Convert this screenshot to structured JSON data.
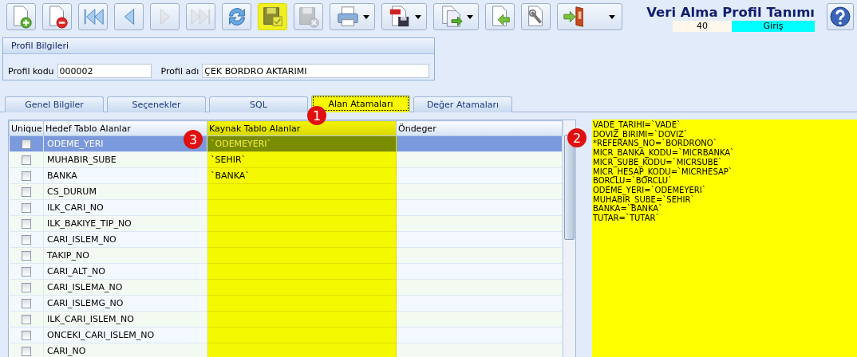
{
  "toolbar": [
    {
      "kind": "new",
      "disabled": false,
      "highlighted": false,
      "dropdown": false
    },
    {
      "kind": "delete",
      "disabled": false,
      "highlighted": false,
      "dropdown": false
    },
    {
      "kind": "first",
      "disabled": false,
      "highlighted": false,
      "dropdown": false
    },
    {
      "kind": "prev",
      "disabled": false,
      "highlighted": false,
      "dropdown": false
    },
    {
      "kind": "next",
      "disabled": true,
      "highlighted": false,
      "dropdown": false
    },
    {
      "kind": "last",
      "disabled": true,
      "highlighted": false,
      "dropdown": false
    },
    {
      "kind": "refresh",
      "disabled": false,
      "highlighted": false,
      "dropdown": false
    },
    {
      "kind": "save",
      "disabled": false,
      "highlighted": true,
      "dropdown": false
    },
    {
      "kind": "cancel",
      "disabled": true,
      "highlighted": false,
      "dropdown": false
    },
    {
      "kind": "print",
      "disabled": false,
      "highlighted": false,
      "dropdown": true
    },
    {
      "kind": "pdf",
      "disabled": false,
      "highlighted": false,
      "dropdown": true
    },
    {
      "kind": "export",
      "disabled": false,
      "highlighted": false,
      "dropdown": true
    },
    {
      "kind": "import",
      "disabled": false,
      "highlighted": false,
      "dropdown": false
    },
    {
      "kind": "tools",
      "disabled": false,
      "highlighted": false,
      "dropdown": false
    },
    {
      "kind": "exit",
      "disabled": false,
      "highlighted": false,
      "dropdown": true
    }
  ],
  "header": {
    "title": "Veri Alma Profil Tanımı",
    "code": "40",
    "mode": "Giriş"
  },
  "profile": {
    "title": "Profil Bilgileri",
    "code_label": "Profil kodu",
    "code_value": "000002",
    "name_label": "Profil adı",
    "name_value": "ÇEK BORDRO AKTARIMI"
  },
  "tabs": [
    {
      "label": "Genel Bilgiler",
      "selected": false
    },
    {
      "label": "Seçenekler",
      "selected": false
    },
    {
      "label": "SQL",
      "selected": false
    },
    {
      "label": "Alan Atamaları",
      "selected": true
    },
    {
      "label": "Değer Atamaları",
      "selected": false
    }
  ],
  "callouts": [
    "1",
    "2",
    "3"
  ],
  "table": {
    "columns": [
      "Unique",
      "Hedef Tablo Alanlar",
      "Kaynak Tablo Alanlar",
      "Öndeger"
    ],
    "rows": [
      {
        "unique": false,
        "target": "ODEME_YERI",
        "source": "`ODEMEYERI`",
        "selected": true
      },
      {
        "unique": false,
        "target": "MUHABIR_SUBE",
        "source": "`SEHIR`",
        "selected": false
      },
      {
        "unique": false,
        "target": "BANKA",
        "source": "`BANKA`",
        "selected": false
      },
      {
        "unique": false,
        "target": "CS_DURUM",
        "selected": false
      },
      {
        "unique": false,
        "target": "ILK_CARI_NO",
        "selected": false
      },
      {
        "unique": false,
        "target": "ILK_BAKIYE_TIP_NO",
        "selected": false
      },
      {
        "unique": false,
        "target": "CARI_ISLEM_NO",
        "selected": false
      },
      {
        "unique": false,
        "target": "TAKIP_NO",
        "selected": false
      },
      {
        "unique": false,
        "target": "CARI_ALT_NO",
        "selected": false
      },
      {
        "unique": false,
        "target": "CARI_ISLEMA_NO",
        "selected": false
      },
      {
        "unique": false,
        "target": "CARI_ISLEMG_NO",
        "selected": false
      },
      {
        "unique": false,
        "target": "ILK_CARI_ISLEM_NO",
        "selected": false
      },
      {
        "unique": false,
        "target": "ONCEKI_CARI_ISLEM_NO",
        "selected": false
      },
      {
        "unique": false,
        "target": "CARI_NO",
        "selected": false
      }
    ]
  },
  "mapping_lines": [
    "VADE_TARIHI=`VADE`",
    "DOVIZ_BIRIMI=`DOVIZ`",
    "*REFERANS_NO=`BORDRONO`",
    "MICR_BANKA_KODU=`MICRBANKA`",
    "MICR_SUBE_KODU=`MICRSUBE`",
    "MICR_HESAP_KODU=`MICRHESAP`",
    "BORCLU=`BORCLU`",
    "ODEME_YERI=`ODEMEYERI`",
    "MUHABIR_SUBE=`SEHIR`",
    "BANKA=`BANKA`",
    "TUTAR=`TUTAR`"
  ]
}
